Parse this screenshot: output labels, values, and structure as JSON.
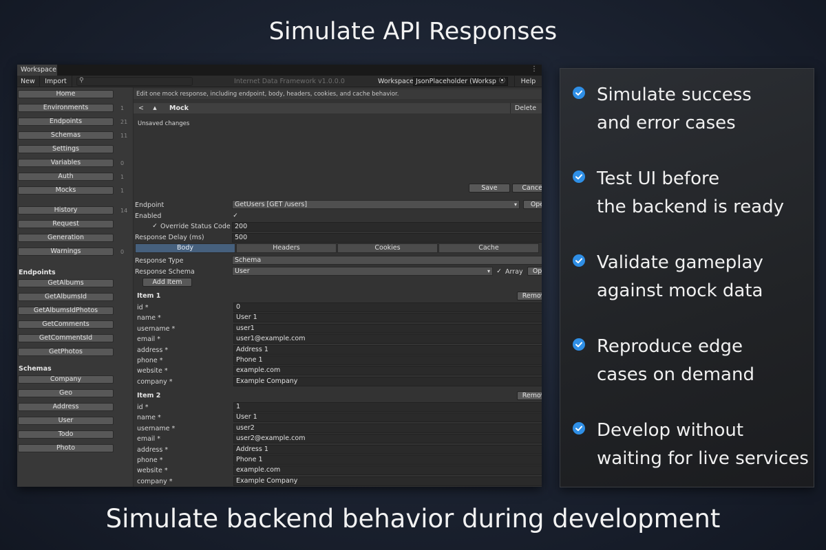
{
  "headline": "Simulate API Responses",
  "footline": "Simulate backend behavior during development",
  "editor": {
    "tab_label": "Workspace",
    "kebab": "⋮",
    "toolbar": {
      "new_label": "New",
      "import_label": "Import",
      "search_placeholder": "",
      "center_title": "Internet Data Framework v1.0.0.0",
      "workspace_label": "Workspace",
      "workspace_value": "JsonPlaceholder (Worksp",
      "help_label": "Help"
    },
    "sidebar": {
      "nav": [
        {
          "label": "Home",
          "count": ""
        },
        {
          "label": "Environments",
          "count": "1"
        },
        {
          "label": "Endpoints",
          "count": "21"
        },
        {
          "label": "Schemas",
          "count": "11"
        },
        {
          "label": "Settings",
          "count": ""
        },
        {
          "label": "Variables",
          "count": "0"
        },
        {
          "label": "Auth",
          "count": "1"
        },
        {
          "label": "Mocks",
          "count": "1"
        }
      ],
      "nav2": [
        {
          "label": "History",
          "count": "14"
        },
        {
          "label": "Request",
          "count": ""
        },
        {
          "label": "Generation",
          "count": ""
        },
        {
          "label": "Warnings",
          "count": "0"
        }
      ],
      "endpoints_heading": "Endpoints",
      "endpoints": [
        "GetAlbums",
        "GetAlbumsId",
        "GetAlbumsIdPhotos",
        "GetComments",
        "GetCommentsId",
        "GetPhotos"
      ],
      "schemas_heading": "Schemas",
      "schemas": [
        "Company",
        "Geo",
        "Address",
        "User",
        "Todo",
        "Photo"
      ]
    },
    "main": {
      "description": "Edit one mock response, including endpoint, body, headers, cookies, and cache behavior.",
      "back_label": "<",
      "up_label": "▲",
      "title": "Mock",
      "delete_label": "Delete",
      "unsaved": "Unsaved changes",
      "save_label": "Save",
      "cancel_label": "Cancel",
      "endpoint_label": "Endpoint",
      "endpoint_value": "GetUsers [GET /users]",
      "open_label": "Open",
      "enabled_label": "Enabled",
      "override_label": "Override Status Code",
      "status_code": "200",
      "delay_label": "Response Delay (ms)",
      "delay_value": "500",
      "tabs": [
        "Body",
        "Headers",
        "Cookies",
        "Cache"
      ],
      "active_tab": "Body",
      "response_type_label": "Response Type",
      "response_type_value": "Schema",
      "response_schema_label": "Response Schema",
      "response_schema_value": "User",
      "array_label": "Array",
      "open2_label": "Open",
      "add_item_label": "Add Item",
      "remove_label": "Remove",
      "field_labels": [
        "id *",
        "name *",
        "username *",
        "email *",
        "address *",
        "phone *",
        "website *",
        "company *"
      ],
      "items": [
        {
          "title": "Item 1",
          "values": [
            "0",
            "User 1",
            "user1",
            "user1@example.com",
            "Address 1",
            "Phone 1",
            "example.com",
            "Example Company"
          ]
        },
        {
          "title": "Item 2",
          "values": [
            "1",
            "User 1",
            "user2",
            "user2@example.com",
            "Address 1",
            "Phone 1",
            "example.com",
            "Example Company"
          ]
        }
      ]
    }
  },
  "features": [
    {
      "line1": "Simulate success",
      "line2": "and error cases"
    },
    {
      "line1": "Test UI before",
      "line2": "the backend is ready"
    },
    {
      "line1": "Validate gameplay",
      "line2": "against mock data"
    },
    {
      "line1": "Reproduce edge",
      "line2": "cases on demand"
    },
    {
      "line1": "Develop without",
      "line2": "waiting for live services"
    }
  ],
  "colors": {
    "accent": "#2f8fe6",
    "active_tab": "#46607d"
  }
}
